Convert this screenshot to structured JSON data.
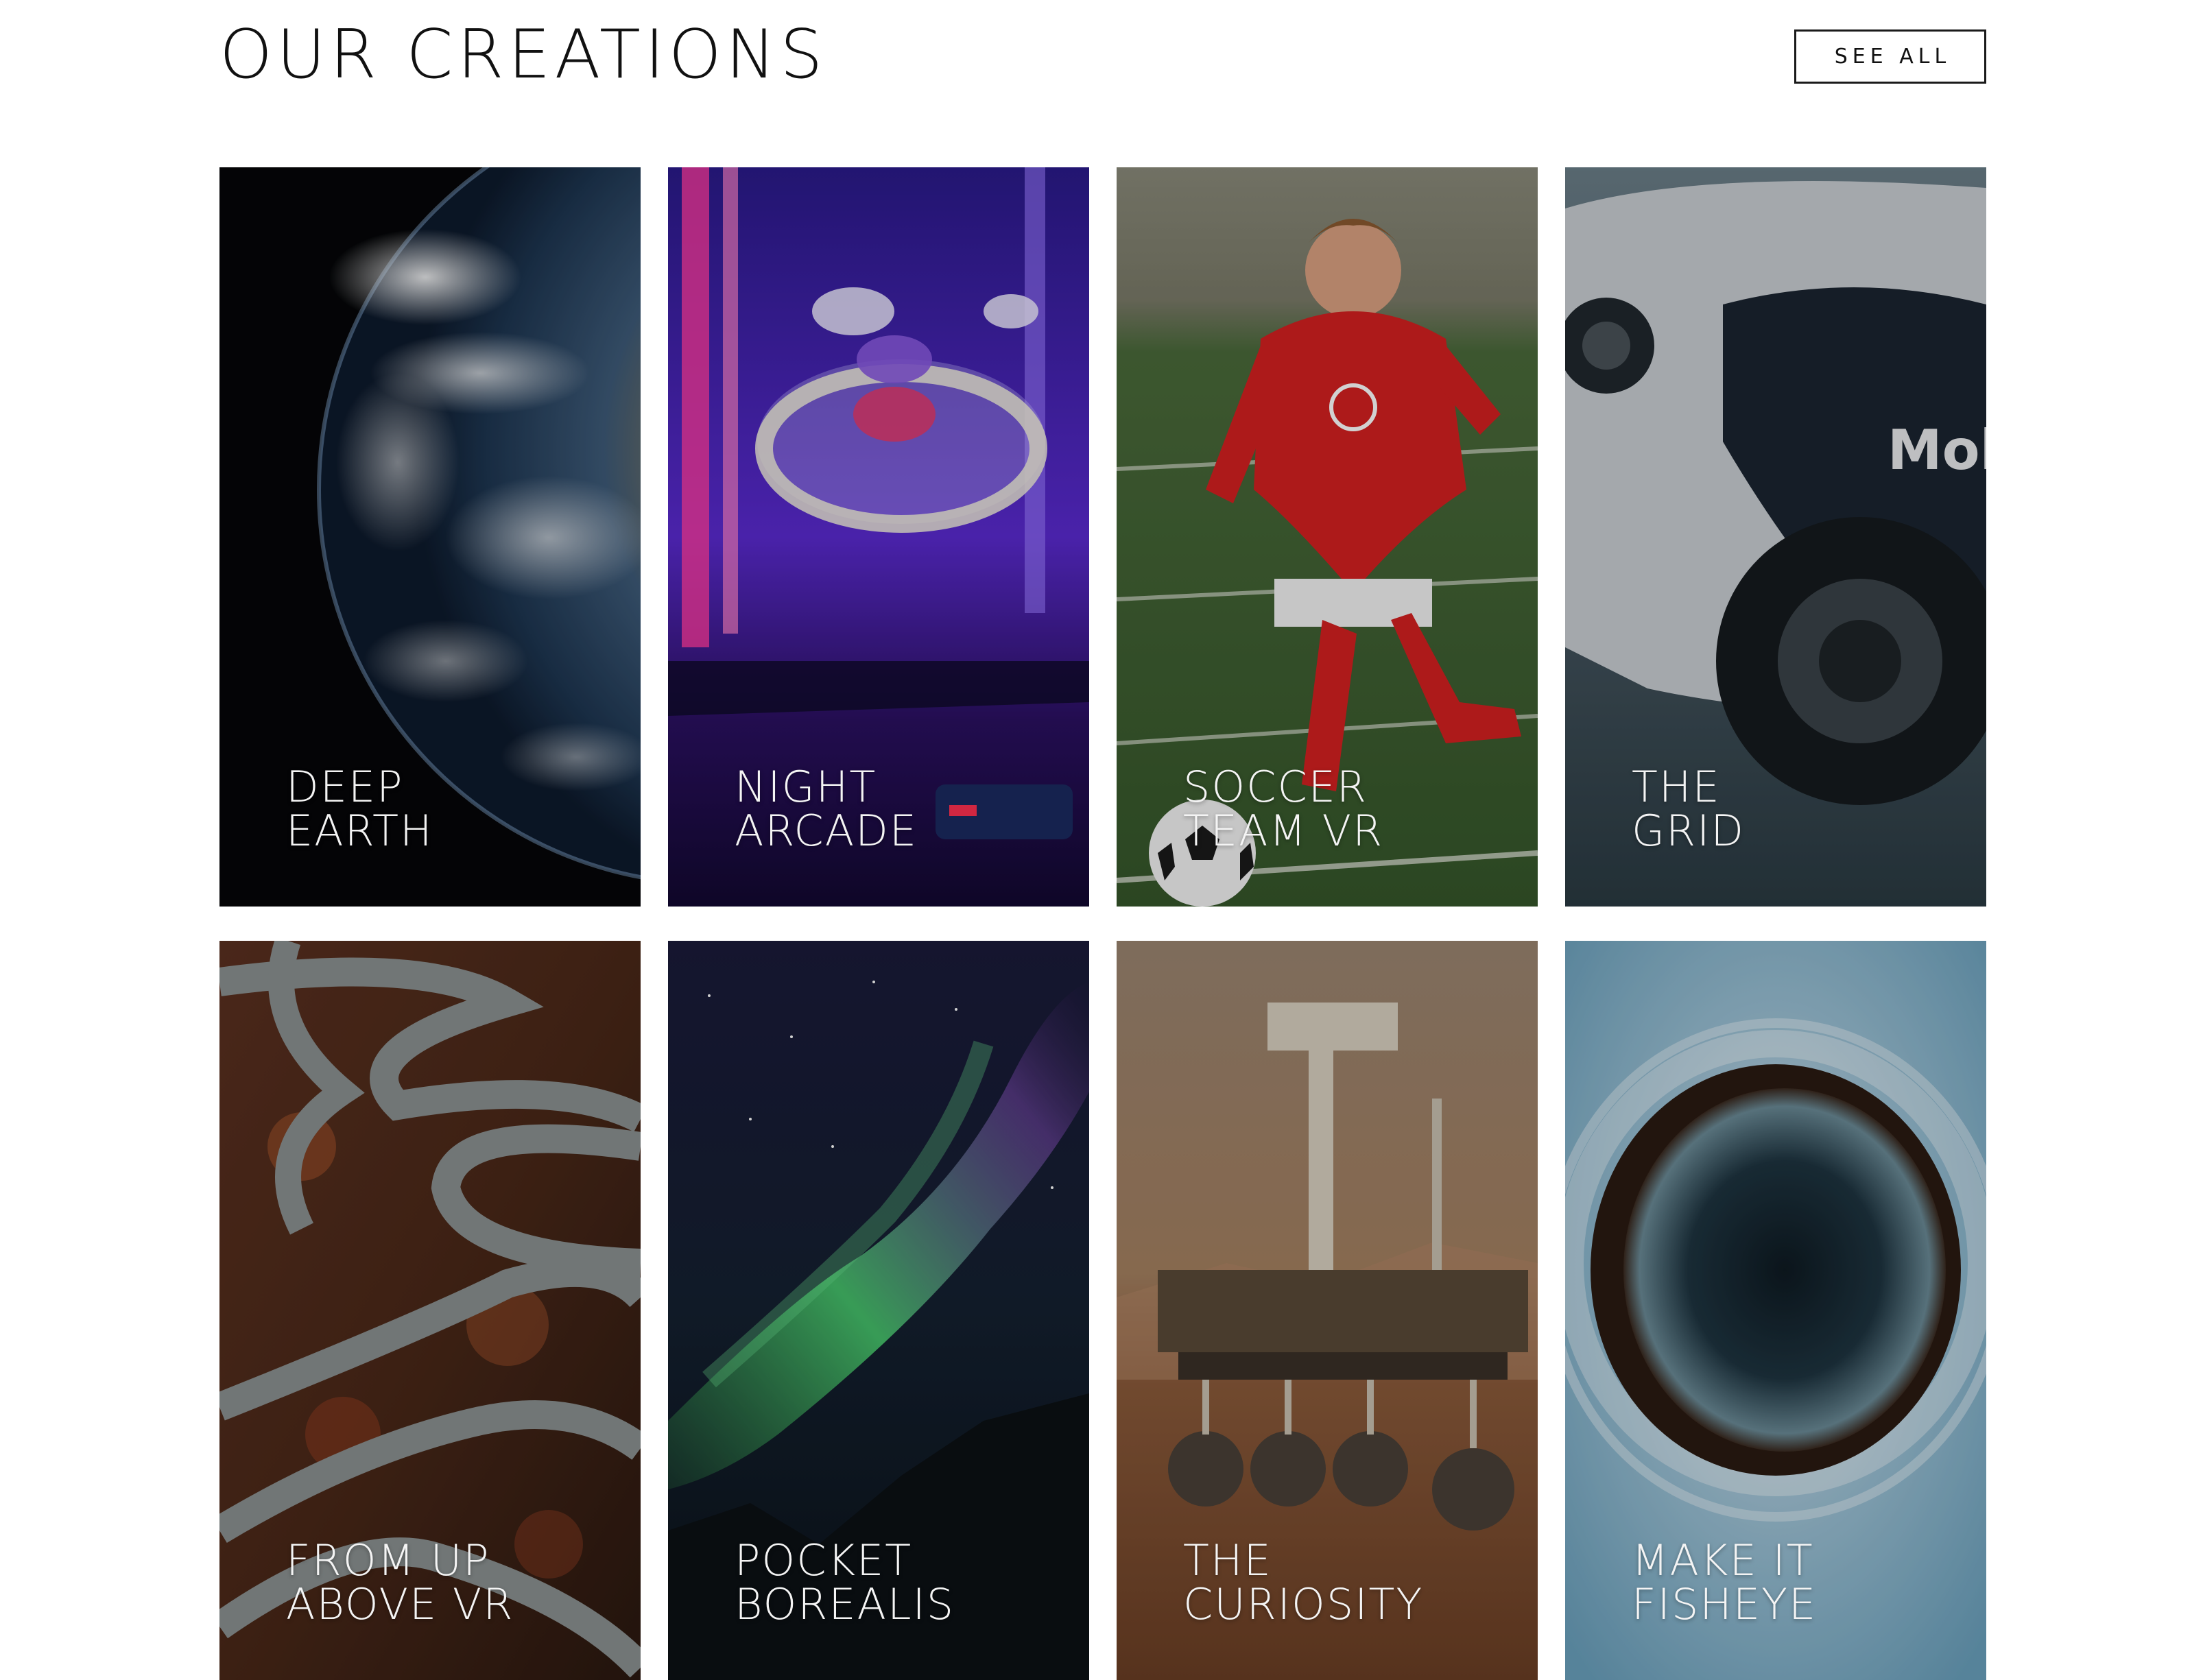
{
  "header": {
    "title": "OUR CREATIONS",
    "see_all_label": "SEE ALL"
  },
  "cards": [
    {
      "line1": "DEEP",
      "line2": "EARTH",
      "image": "earth-from-space"
    },
    {
      "line1": "NIGHT",
      "line2": "ARCADE",
      "image": "skee-ball-arcade"
    },
    {
      "line1": "SOCCER",
      "line2": "TEAM VR",
      "image": "soccer-player"
    },
    {
      "line1": "THE",
      "line2": "GRID",
      "image": "race-car"
    },
    {
      "line1": "FROM UP",
      "line2": "ABOVE VR",
      "image": "aerial-winding-road"
    },
    {
      "line1": "POCKET",
      "line2": "BOREALIS",
      "image": "aurora-borealis"
    },
    {
      "line1": "THE",
      "line2": "CURIOSITY",
      "image": "mars-rover"
    },
    {
      "line1": "MAKE IT",
      "line2": "FISHEYE",
      "image": "fisheye-planet"
    }
  ]
}
